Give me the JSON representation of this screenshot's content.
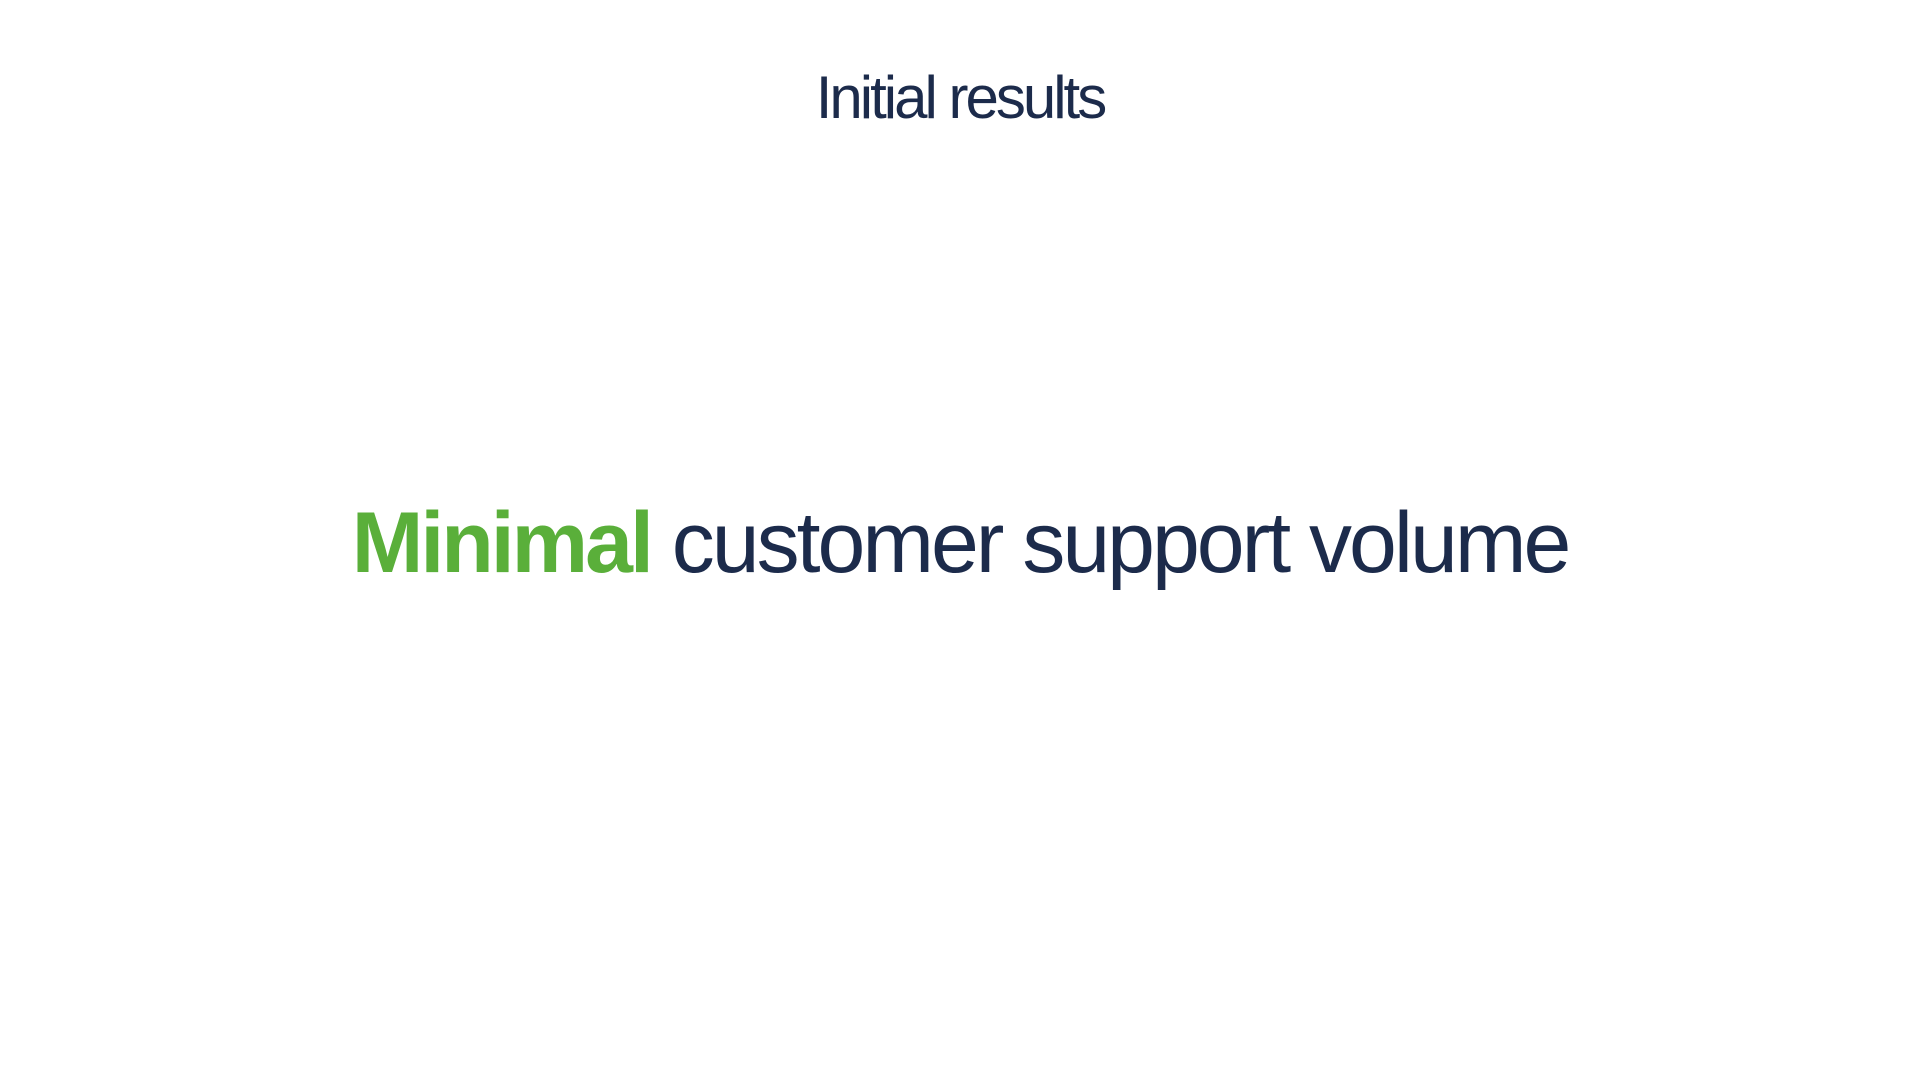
{
  "slide": {
    "title": "Initial results",
    "headline": {
      "accent_word": "Minimal",
      "rest_text": "customer support volume"
    }
  },
  "colors": {
    "background": "#ffffff",
    "text": "#1c2b4b",
    "accent": "#5aaf3a"
  }
}
